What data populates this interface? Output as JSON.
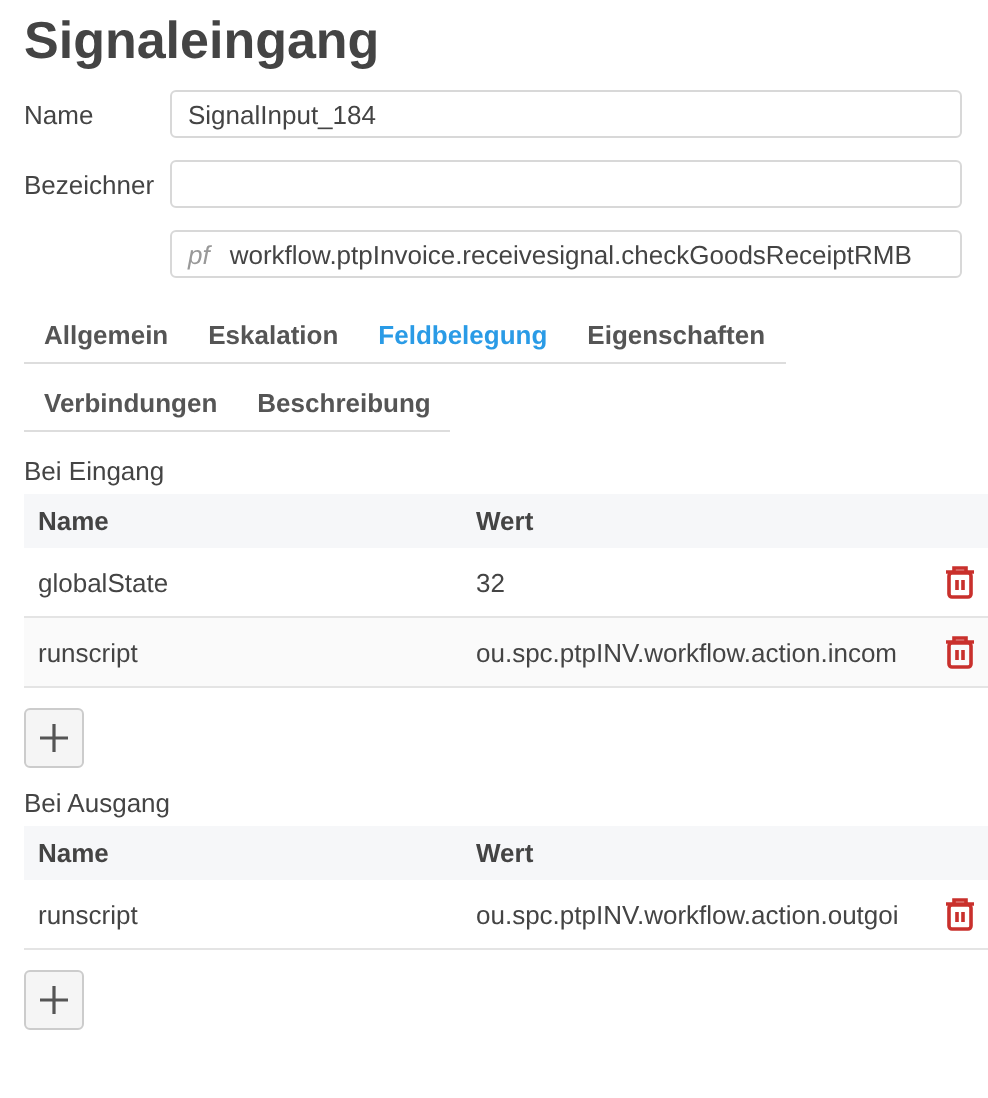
{
  "title": "Signaleingang",
  "fields": [
    {
      "label": "Name",
      "value": "SignalInput_184"
    },
    {
      "label": "Bezeichner"
    },
    {
      "prefix": "pf",
      "value": "workflow.ptpInvoice.receivesignal.checkGoodsReceiptRMB"
    }
  ],
  "tabs": [
    {
      "label": "Allgemein",
      "selected": false
    },
    {
      "label": "Eskalation",
      "selected": false
    },
    {
      "label": "Feldbelegung",
      "selected": true
    },
    {
      "label": "Eigenschaften",
      "selected": false
    },
    {
      "label": "Verbindungen",
      "selected": false
    },
    {
      "label": "Beschreibung",
      "selected": false
    }
  ],
  "sections": [
    {
      "title": "Bei Eingang",
      "columns": [
        "Name",
        "Wert"
      ],
      "rows": [
        {
          "name": "globalState",
          "value": "32"
        },
        {
          "name": "runscript",
          "value": "ou.spc.ptpINV.workflow.action.incom"
        }
      ]
    },
    {
      "title": "Bei Ausgang",
      "columns": [
        "Name",
        "Wert"
      ],
      "rows": [
        {
          "name": "runscript",
          "value": "ou.spc.ptpINV.workflow.action.outgoi"
        }
      ]
    }
  ]
}
